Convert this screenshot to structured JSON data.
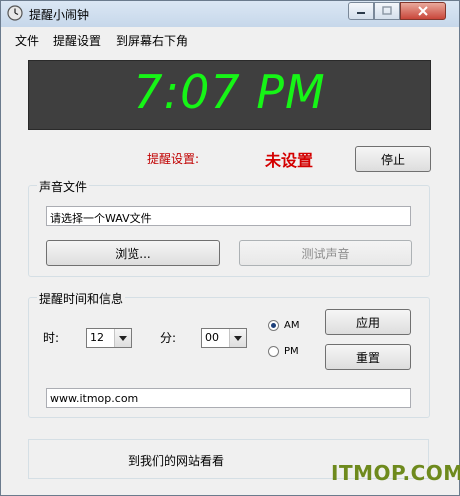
{
  "window": {
    "title": "提醒小闹钟",
    "icon": "clock-icon"
  },
  "menu": {
    "items": [
      "文件",
      "提醒设置",
      "到屏幕右下角"
    ]
  },
  "clock": {
    "time": "7:07 PM",
    "color": "#16f516"
  },
  "alarm": {
    "label": "提醒设置:",
    "status": "未设置",
    "stop_button": "停止",
    "status_color": "#d40000"
  },
  "sound": {
    "group_title": "声音文件",
    "file_value": "请选择一个WAV文件",
    "browse_button": "浏览...",
    "test_button": "测试声音"
  },
  "reminder": {
    "group_title": "提醒时间和信息",
    "hour_label": "时:",
    "hour_value": "12",
    "minute_label": "分:",
    "minute_value": "00",
    "am_label": "AM",
    "pm_label": "PM",
    "apply_button": "应用",
    "reset_button": "重置",
    "message_value": "www.itmop.com"
  },
  "footer": {
    "link_text": "到我们的网站看看"
  },
  "watermark": {
    "text": "ITMOP.COM",
    "color": "#6e8a1d"
  }
}
